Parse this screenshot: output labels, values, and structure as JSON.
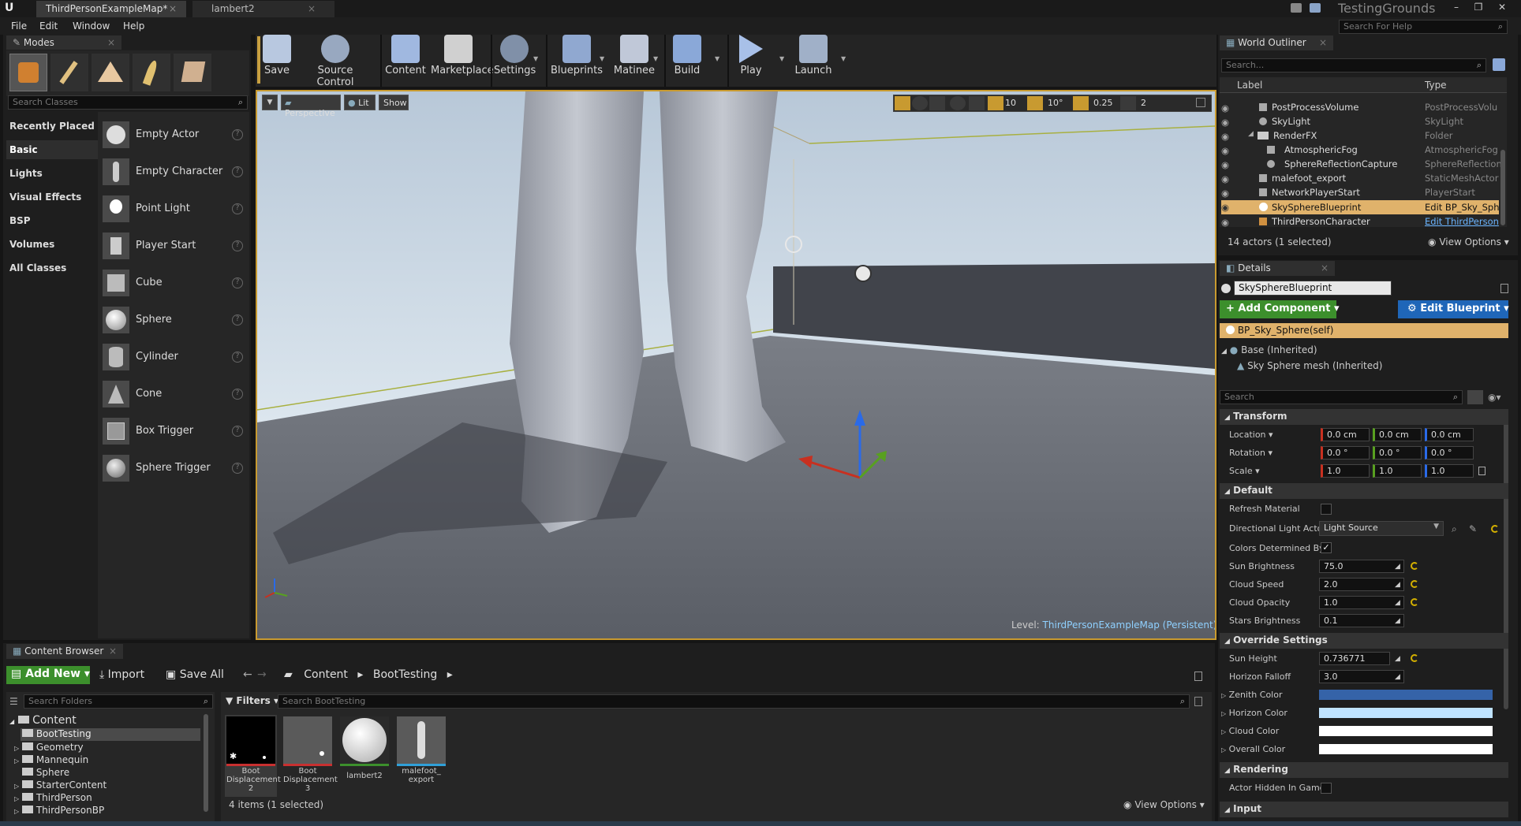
{
  "titlebar": {
    "tab_map": "ThirdPersonExampleMap*",
    "tab_asset": "lambert2",
    "project": "TestingGrounds",
    "help_search": "Search For Help"
  },
  "menu": [
    "File",
    "Edit",
    "Window",
    "Help"
  ],
  "modes": {
    "tab": "Modes",
    "search": "Search Classes",
    "categories": [
      "Recently Placed",
      "Basic",
      "Lights",
      "Visual Effects",
      "BSP",
      "Volumes",
      "All Classes"
    ],
    "items": [
      "Empty Actor",
      "Empty Character",
      "Point Light",
      "Player Start",
      "Cube",
      "Sphere",
      "Cylinder",
      "Cone",
      "Box Trigger",
      "Sphere Trigger"
    ]
  },
  "toolbar": [
    "Save",
    "Source Control",
    "Content",
    "Marketplace",
    "Settings",
    "Blueprints",
    "Matinee",
    "Build",
    "Play",
    "Launch"
  ],
  "viewport": {
    "perspective": "Perspective",
    "lit": "Lit",
    "show": "Show",
    "grid": "10",
    "angle": "10°",
    "scale": "0.25",
    "cam": "2",
    "level_label": "Level:",
    "level_name": "ThirdPersonExampleMap (Persistent)"
  },
  "outliner": {
    "tab": "World Outliner",
    "search": "Search...",
    "col_label": "Label",
    "col_type": "Type",
    "rows": [
      {
        "label": "PostProcessVolume",
        "type": "PostProcessVolu"
      },
      {
        "label": "SkyLight",
        "type": "SkyLight"
      },
      {
        "label": "RenderFX",
        "type": "Folder"
      },
      {
        "label": "AtmosphericFog",
        "type": "AtmosphericFog"
      },
      {
        "label": "SphereReflectionCapture",
        "type": "SphereReflection("
      },
      {
        "label": "malefoot_export",
        "type": "StaticMeshActor"
      },
      {
        "label": "NetworkPlayerStart",
        "type": "PlayerStart"
      },
      {
        "label": "SkySphereBlueprint",
        "type": "Edit BP_Sky_Sph"
      },
      {
        "label": "ThirdPersonCharacter",
        "type": "Edit ThirdPerson"
      }
    ],
    "status": "14 actors (1 selected)",
    "view_options": "View Options"
  },
  "details": {
    "tab": "Details",
    "name": "SkySphereBlueprint",
    "add_component": "Add Component",
    "edit_blueprint": "Edit Blueprint",
    "self": "BP_Sky_Sphere(self)",
    "base": "Base (Inherited)",
    "mesh": "Sky Sphere mesh (Inherited)",
    "search": "Search",
    "transform": {
      "title": "Transform",
      "location_label": "Location",
      "rotation_label": "Rotation",
      "scale_label": "Scale",
      "location": [
        "0.0 cm",
        "0.0 cm",
        "0.0 cm"
      ],
      "rotation": [
        "0.0 °",
        "0.0 °",
        "0.0 °"
      ],
      "scale": [
        "1.0",
        "1.0",
        "1.0"
      ]
    },
    "default": {
      "title": "Default",
      "refresh": "Refresh Material",
      "dir_light": "Directional Light Acto",
      "dir_light_value": "Light Source",
      "colors_det": "Colors Determined By",
      "sun_brightness": "Sun Brightness",
      "sun_brightness_v": "75.0",
      "cloud_speed": "Cloud Speed",
      "cloud_speed_v": "2.0",
      "cloud_opacity": "Cloud Opacity",
      "cloud_opacity_v": "1.0",
      "stars": "Stars Brightness",
      "stars_v": "0.1"
    },
    "override": {
      "title": "Override Settings",
      "sun_height": "Sun Height",
      "sun_height_v": "0.736771",
      "horizon_falloff": "Horizon Falloff",
      "horizon_falloff_v": "3.0",
      "zenith": "Zenith Color",
      "horizon": "Horizon Color",
      "cloud_color": "Cloud Color",
      "overall": "Overall Color"
    },
    "rendering": {
      "title": "Rendering",
      "hidden": "Actor Hidden In Game"
    },
    "input": {
      "title": "Input"
    }
  },
  "content_browser": {
    "tab": "Content Browser",
    "add_new": "Add New",
    "import": "Import",
    "save_all": "Save All",
    "path_root": "Content",
    "path_child": "BootTesting",
    "search_folders": "Search Folders",
    "filters": "Filters",
    "search_assets": "Search BootTesting",
    "tree": [
      "Content",
      "BootTesting",
      "Geometry",
      "Mannequin",
      "Sphere",
      "StarterContent",
      "ThirdPerson",
      "ThirdPersonBP"
    ],
    "assets": [
      "Boot Displacement 2",
      "Boot Displacement 3",
      "lambert2",
      "malefoot_ export"
    ],
    "status": "4 items (1 selected)",
    "view_options": "View Options"
  },
  "colors": {
    "accent": "#d4a24c",
    "selection": "#e0b26b",
    "green": "#3c8f2c",
    "blue": "#1f66b8",
    "zenith": "#3563a8",
    "horizon": "#bfe3ff"
  }
}
